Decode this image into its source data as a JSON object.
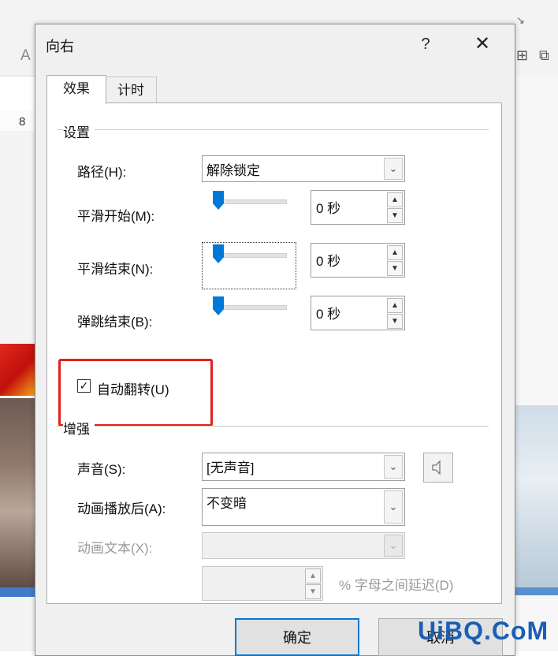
{
  "background": {
    "ruler_number": "8",
    "ribbon_icon_left": "A",
    "ribbon_icon_corner": "↘",
    "ribbon_icon_right1": "⊞",
    "ribbon_icon_right2": "⧉"
  },
  "dialog": {
    "title": "向右",
    "help_label": "?",
    "close_label": "✕",
    "tabs": [
      {
        "label": "效果",
        "active": true
      },
      {
        "label": "计时",
        "active": false
      }
    ],
    "settings": {
      "section_title": "设置",
      "path": {
        "label": "路径(H):",
        "value": "解除锁定"
      },
      "smooth_start": {
        "label": "平滑开始(M):",
        "value": "0 秒",
        "slider_fraction": 0
      },
      "smooth_end": {
        "label": "平滑结束(N):",
        "value": "0 秒",
        "slider_fraction": 0
      },
      "bounce_end": {
        "label": "弹跳结束(B):",
        "value": "0 秒",
        "slider_fraction": 0
      },
      "auto_reverse": {
        "label": "自动翻转(U)",
        "checked": true,
        "check_glyph": "✓"
      }
    },
    "enhancements": {
      "section_title": "增强",
      "sound": {
        "label": "声音(S):",
        "value": "[无声音]"
      },
      "after_animation": {
        "label": "动画播放后(A):",
        "value": "不变暗"
      },
      "animate_text": {
        "label": "动画文本(X):",
        "value": ""
      },
      "delay": {
        "value": "",
        "suffix_label": "% 字母之间延迟(D)"
      }
    },
    "buttons": {
      "ok": "确定",
      "cancel": "取消"
    }
  },
  "watermark": "UiBQ.CoM",
  "colors": {
    "accent": "#0078d7",
    "highlight": "#e0201b",
    "watermark": "#1a5fb4"
  }
}
